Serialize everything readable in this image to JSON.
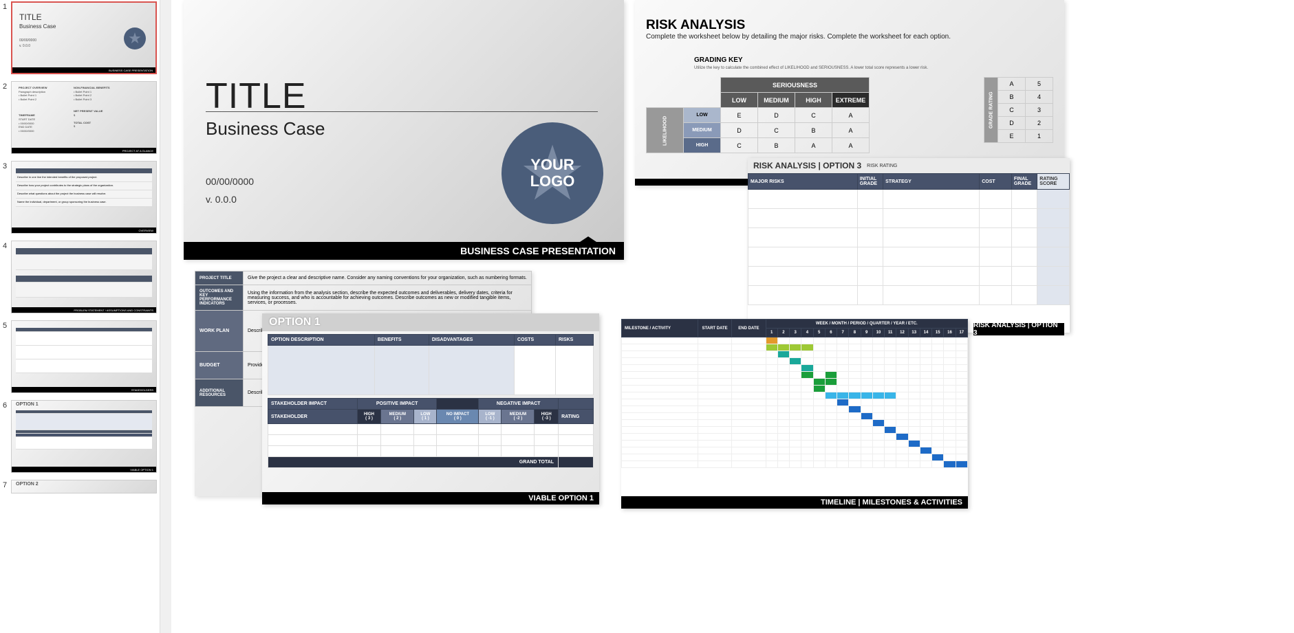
{
  "sidebar": {
    "slides": [
      {
        "num": "1",
        "title": "TITLE",
        "sub": "Business Case",
        "footer": "BUSINESS CASE PRESENTATION",
        "date": "00/00/0000",
        "ver": "v. 0.0.0",
        "logo": "YOUR LOGO"
      },
      {
        "num": "2",
        "sections": [
          "PROJECT OVERVIEW",
          "NON-FINANCIAL BENEFITS",
          "TIMEFRAME",
          "NET PRESENT VALUE",
          "TOTAL COST"
        ],
        "bullets": [
          "Bullet Point 1",
          "Bullet Point 2",
          "Bullet Point 3"
        ],
        "footer": "PROJECT AT A GLANCE"
      },
      {
        "num": "3",
        "rows": [
          "Describe in one line the intended benefits of the proposed project.",
          "Describe how your project contributes to the strategic plans of the organization.",
          "Describe what questions about the project the business case will resolve.",
          "Name the individual, department, or group sponsoring the business case."
        ],
        "footer": "OVERVIEW"
      },
      {
        "num": "4",
        "footer": "PROBLEM STATEMENT / ASSUMPTIONS AND CONSTRAINTS"
      },
      {
        "num": "5",
        "footer": "STAKEHOLDERS"
      },
      {
        "num": "6",
        "title": "OPTION 1",
        "footer": "VIABLE OPTION 1"
      },
      {
        "num": "7",
        "title": "OPTION 2"
      }
    ]
  },
  "slide1": {
    "title": "TITLE",
    "subtitle": "Business Case",
    "date": "00/00/0000",
    "version": "v. 0.0.0",
    "logo_line1": "YOUR",
    "logo_line2": "LOGO",
    "footer": "BUSINESS CASE PRESENTATION"
  },
  "risk": {
    "title": "RISK ANALYSIS",
    "subtitle": "Complete the worksheet below by detailing the major risks.  Complete the worksheet for each option.",
    "grading_key": "GRADING KEY",
    "grading_sub": "Utilize the key to calculate the combined effect of LIKELIHOOD and SERIOUSNESS. A lower total score represents a lower risk.",
    "ser_header": "SERIOUSNESS",
    "lik_header": "LIKELIHOOD",
    "cols": [
      "LOW",
      "MEDIUM",
      "HIGH",
      "EXTREME"
    ],
    "rows": [
      "LOW",
      "MEDIUM",
      "HIGH"
    ],
    "grid": [
      [
        "E",
        "D",
        "C",
        "A"
      ],
      [
        "D",
        "C",
        "B",
        "A"
      ],
      [
        "C",
        "B",
        "A",
        "A"
      ]
    ],
    "grade_header": "GRADE RATING",
    "grades": [
      [
        "A",
        "5"
      ],
      [
        "B",
        "4"
      ],
      [
        "C",
        "3"
      ],
      [
        "D",
        "2"
      ],
      [
        "E",
        "1"
      ]
    ]
  },
  "ra3": {
    "title": "RISK ANALYSIS | OPTION 3",
    "cols": [
      "MAJOR RISKS",
      "INITIAL GRADE",
      "STRATEGY",
      "COST",
      "FINAL GRADE",
      "RATING SCORE"
    ],
    "risk_rating": "RISK RATING",
    "footer": "RISK ANALYSIS | OPTION 3"
  },
  "appr": {
    "rows": [
      [
        "PROJECT TITLE",
        "Give the project a clear and descriptive name. Consider any naming conventions for your organization, such as numbering formats."
      ],
      [
        "OUTCOMES AND KEY PERFORMANCE INDICATORS",
        "Using the information from the analysis section, describe the expected outcomes and deliverables, delivery dates, criteria for measuring success, and who is accountable for achieving outcomes. Describe outcomes as new or modified tangible items, services, or processes."
      ],
      [
        "WORK PLAN",
        "Describe..."
      ],
      [
        "BUDGET",
        "Provide..."
      ],
      [
        "ADDITIONAL RESOURCES",
        "Describe..."
      ]
    ]
  },
  "opt1": {
    "title": "OPTION 1",
    "hdr": [
      "OPTION DESCRIPTION",
      "BENEFITS",
      "DISADVANTAGES",
      "COSTS",
      "RISKS"
    ],
    "stake_hdr": "STAKEHOLDER IMPACT",
    "pos": "POSITIVE IMPACT",
    "neg": "NEGATIVE IMPACT",
    "stake": "STAKEHOLDER",
    "rating": "RATING",
    "scale": [
      [
        "HIGH",
        "( 3 )"
      ],
      [
        "MEDIUM",
        "( 2 )"
      ],
      [
        "LOW",
        "( 1 )"
      ],
      [
        "NO IMPACT",
        "( 0 )"
      ],
      [
        "LOW",
        "( -1 )"
      ],
      [
        "MEDIUM",
        "( -2 )"
      ],
      [
        "HIGH",
        "( -3 )"
      ]
    ],
    "grand": "GRAND TOTAL",
    "footer": "VIABLE OPTION 1"
  },
  "tl": {
    "h1": "MILESTONE / ACTIVITY",
    "h2": "START DATE",
    "h3": "END DATE",
    "h4": "WEEK / MONTH / PERIOD / QUARTER / YEAR / ETC.",
    "nums": [
      "1",
      "2",
      "3",
      "4",
      "5",
      "6",
      "7",
      "8",
      "9",
      "10",
      "11",
      "12",
      "13",
      "14",
      "15",
      "16",
      "17"
    ],
    "footer": "TIMELINE | MILESTONES & ACTIVITIES"
  }
}
